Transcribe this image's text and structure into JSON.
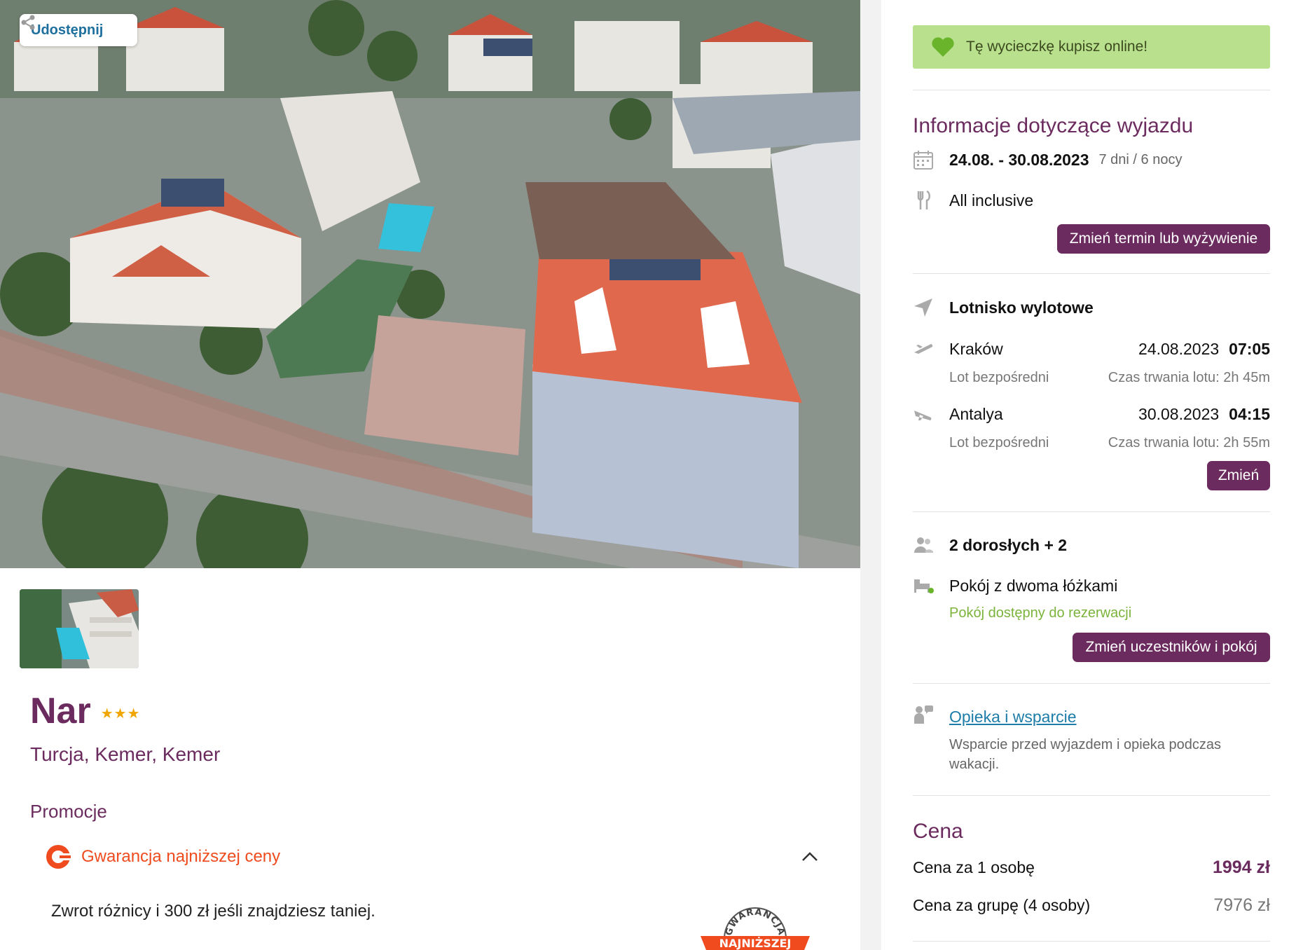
{
  "share": {
    "label": "Udostępnij",
    "icon": "share-icon"
  },
  "hotel": {
    "name": "Nar",
    "stars": "★★★",
    "location": "Turcja, Kemer, Kemer"
  },
  "promotions": {
    "heading": "Promocje",
    "item_label": "Gwarancja najniższej ceny",
    "description": "Zwrot różnicy i 300 zł jeśli znajdziesz taniej.",
    "badge_top": "GWARANCJA",
    "badge_ribbon": "NAJNIŻSZEJ"
  },
  "banner": {
    "text": "Tę wycieczkę kupisz online!",
    "color": "#b9e08c"
  },
  "trip": {
    "title": "Informacje dotyczące wyjazdu",
    "dates": "24.08. - 30.08.2023",
    "duration": "7 dni / 6 nocy",
    "board": "All inclusive",
    "change_button": "Zmień termin lub wyżywienie"
  },
  "flights": {
    "heading": "Lotnisko wylotowe",
    "outbound": {
      "city": "Kraków",
      "date": "24.08.2023",
      "time": "07:05",
      "type": "Lot bezpośredni",
      "duration": "Czas trwania lotu: 2h 45m"
    },
    "return": {
      "city": "Antalya",
      "date": "30.08.2023",
      "time": "04:15",
      "type": "Lot bezpośredni",
      "duration": "Czas trwania lotu: 2h 55m"
    },
    "change_button": "Zmień"
  },
  "participants": {
    "people": "2 dorosłych + 2",
    "room": "Pokój z dwoma łóżkami",
    "availability": "Pokój dostępny do rezerwacji",
    "change_button": "Zmień uczestników i pokój"
  },
  "support": {
    "link": "Opieka i wsparcie",
    "description": "Wsparcie przed wyjazdem i opieka podczas wakacji."
  },
  "price": {
    "title": "Cena",
    "per_person_label": "Cena za 1 osobę",
    "per_person_value": "1994 zł",
    "group_label": "Cena za grupę (4 osoby)",
    "group_value": "7976 zł"
  },
  "colors": {
    "brand": "#6b2b5e",
    "promo": "#ef4b1f",
    "link": "#1d7da8",
    "available": "#7bb33b"
  }
}
